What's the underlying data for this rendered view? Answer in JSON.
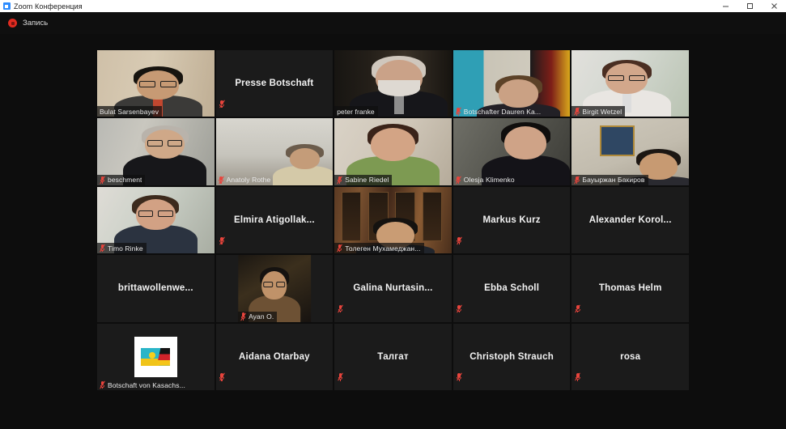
{
  "window": {
    "title": "Zoom Конференция",
    "app_icon": "zoom-camera-icon",
    "controls": {
      "minimize": "minimize-icon",
      "maximize": "maximize-icon",
      "close": "close-icon"
    }
  },
  "recording": {
    "label": "Запись",
    "icon": "recording-stop-icon",
    "dot_color": "#e02b20"
  },
  "colors": {
    "stage_background": "#0d0d0d",
    "tile_background": "#1b1b1b",
    "active_speaker_border": "#c9e62e",
    "muted_mic": "#e8443c",
    "name_text": "#e8e8e8"
  },
  "gallery": {
    "columns": 5,
    "rows": 5,
    "participants": [
      {
        "name": "Bulat Sarsenbayev",
        "video": true,
        "muted": false,
        "speaking": false,
        "badge_bg": true,
        "style": "p-bulat"
      },
      {
        "name": "Presse Botschaft",
        "video": false,
        "muted": true,
        "speaking": false
      },
      {
        "name": "peter franke",
        "video": true,
        "muted": false,
        "speaking": true,
        "badge_bg": true,
        "style": "p-peter"
      },
      {
        "name": "Botschafter Dauren Ka...",
        "video": true,
        "muted": true,
        "speaking": false,
        "badge_bg": false,
        "style": "p-dauren"
      },
      {
        "name": "Birgit Wetzel",
        "video": true,
        "muted": true,
        "speaking": false,
        "badge_bg": true,
        "style": "p-birgit"
      },
      {
        "name": "beschment",
        "video": true,
        "muted": true,
        "speaking": false,
        "badge_bg": true,
        "style": "p-beschment"
      },
      {
        "name": "Anatoly Rothe",
        "video": true,
        "muted": true,
        "speaking": false,
        "badge_bg": false,
        "style": "p-anatoly"
      },
      {
        "name": "Sabine Riedel",
        "video": true,
        "muted": true,
        "speaking": false,
        "badge_bg": true,
        "style": "p-sabine"
      },
      {
        "name": "Olesja Klimenko",
        "video": true,
        "muted": true,
        "speaking": false,
        "badge_bg": false,
        "style": "p-olesja"
      },
      {
        "name": "Бауыржан Бакиров",
        "video": true,
        "muted": true,
        "speaking": false,
        "badge_bg": true,
        "style": "p-bauyrzhan"
      },
      {
        "name": "Timo Rinke",
        "video": true,
        "muted": true,
        "speaking": false,
        "badge_bg": true,
        "style": "p-timo"
      },
      {
        "name": "Elmira  Atigollak...",
        "video": false,
        "muted": true,
        "speaking": false
      },
      {
        "name": "Толеген Мухамеджан...",
        "video": true,
        "muted": true,
        "speaking": false,
        "badge_bg": true,
        "style": "p-tolegen"
      },
      {
        "name": "Markus Kurz",
        "video": false,
        "muted": true,
        "speaking": false
      },
      {
        "name": "Alexander Korol...",
        "video": false,
        "muted": false,
        "speaking": false
      },
      {
        "name": "brittawollenwe...",
        "video": false,
        "muted": false,
        "speaking": false
      },
      {
        "name": "Ayan O.",
        "video": true,
        "muted": true,
        "speaking": false,
        "badge_bg": true,
        "narrow": true,
        "style": "p-ayan"
      },
      {
        "name": "Galina  Nurtasin...",
        "video": false,
        "muted": true,
        "speaking": false
      },
      {
        "name": "Ebba Scholl",
        "video": false,
        "muted": true,
        "speaking": false
      },
      {
        "name": "Thomas Helm",
        "video": false,
        "muted": true,
        "speaking": false
      },
      {
        "name": "Botschaft von Kasachs...",
        "video": false,
        "muted": true,
        "speaking": false,
        "avatar": "kazakh-german-flag-avatar"
      },
      {
        "name": "Aidana Otarbay",
        "video": false,
        "muted": true,
        "speaking": false
      },
      {
        "name": "Талгат",
        "video": false,
        "muted": true,
        "speaking": false
      },
      {
        "name": "Christoph Strauch",
        "video": false,
        "muted": true,
        "speaking": false
      },
      {
        "name": "rosa",
        "video": false,
        "muted": true,
        "speaking": false
      }
    ]
  }
}
